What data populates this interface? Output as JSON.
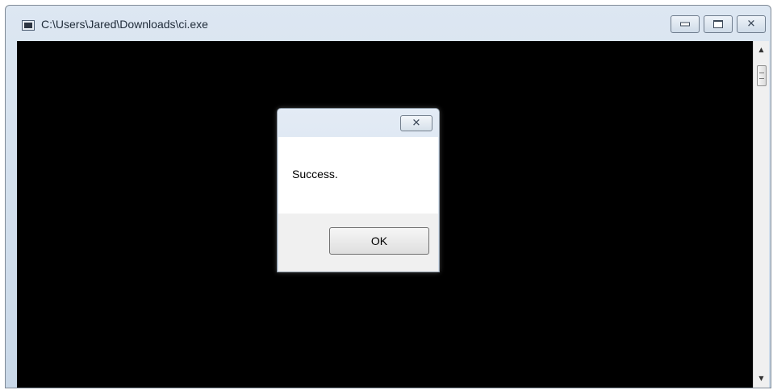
{
  "window": {
    "title": "C:\\Users\\Jared\\Downloads\\ci.exe",
    "icon": "console-window-icon",
    "console_background": "#000000",
    "buttons": {
      "minimize": "minimize-icon",
      "maximize": "maximize-icon",
      "close": "✕"
    }
  },
  "dialog": {
    "close": "✕",
    "message": "Success.",
    "ok_label": "OK"
  },
  "scrollbar": {
    "up_arrow": "▲",
    "down_arrow": "▼"
  }
}
